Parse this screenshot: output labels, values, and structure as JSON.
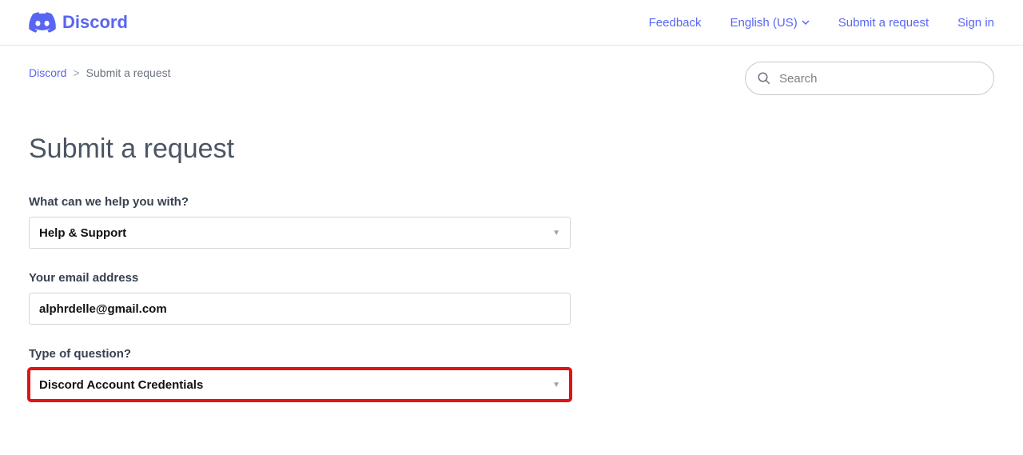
{
  "header": {
    "logo_text": "Discord",
    "nav": {
      "feedback": "Feedback",
      "language": "English (US)",
      "submit": "Submit a request",
      "signin": "Sign in"
    }
  },
  "breadcrumb": {
    "root": "Discord",
    "current": "Submit a request"
  },
  "search": {
    "placeholder": "Search"
  },
  "page": {
    "title": "Submit a request"
  },
  "form": {
    "help_label": "What can we help you with?",
    "help_value": "Help & Support",
    "email_label": "Your email address",
    "email_value": "alphrdelle@gmail.com",
    "type_label": "Type of question?",
    "type_value": "Discord Account Credentials"
  }
}
